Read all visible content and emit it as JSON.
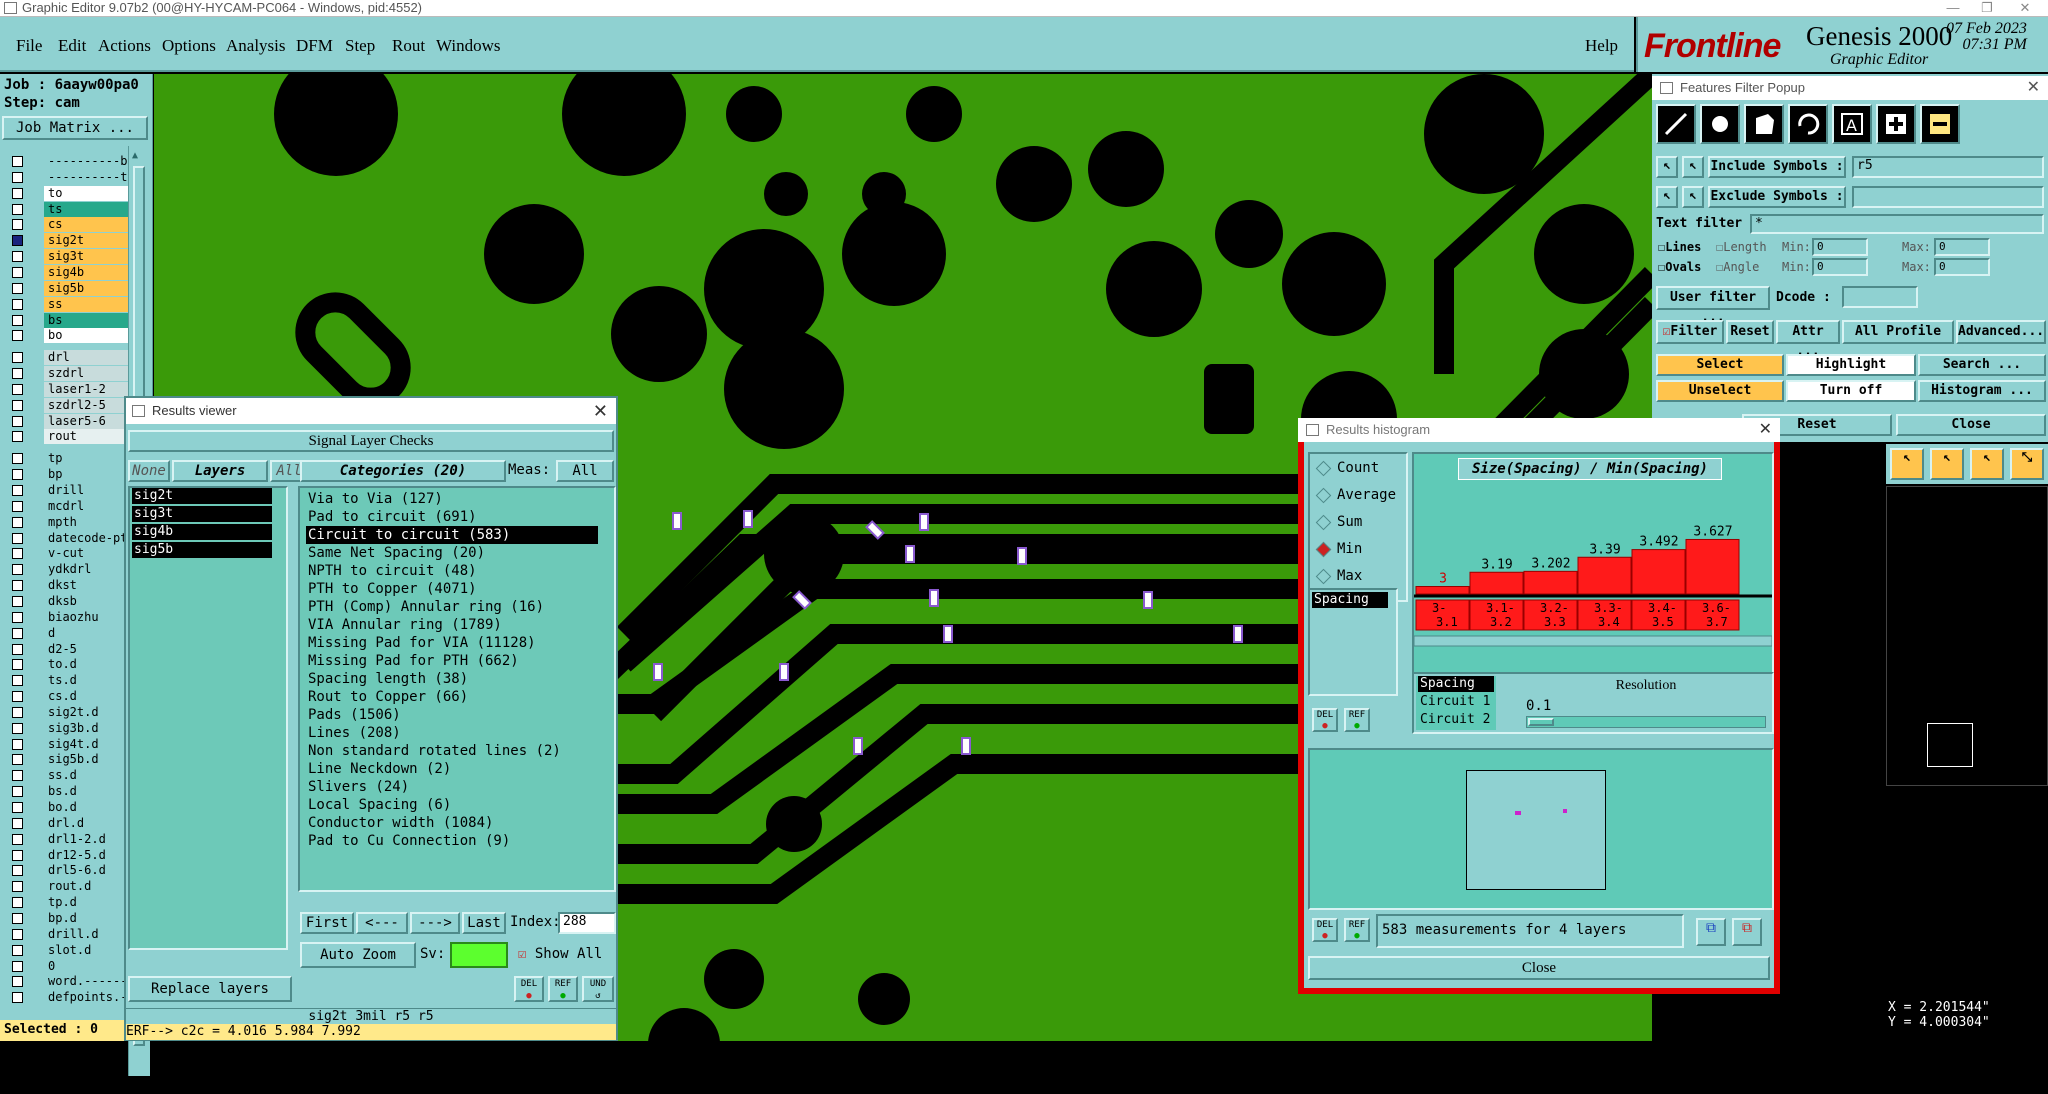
{
  "window_title": "Graphic Editor 9.07b2 (00@HY-HYCAM-PC064 - Windows, pid:4552)",
  "menu": [
    "File",
    "Edit",
    "Actions",
    "Options",
    "Analysis",
    "DFM",
    "Step",
    "Rout",
    "Windows"
  ],
  "help_label": "Help",
  "brand": {
    "logo": "Frontline",
    "product": "Genesis 2000",
    "subtitle": "Graphic Editor",
    "date": "07 Feb 2023",
    "time": "07:31 PM"
  },
  "left_panel": {
    "job": "Job : 6aayw00pa0",
    "step": "Step: cam",
    "job_matrix": "Job Matrix ...",
    "layers": [
      {
        "name": "----------b",
        "color": "#8fd1d1"
      },
      {
        "name": "----------t",
        "color": "#8fd1d1"
      },
      {
        "name": "to",
        "color": "#ffffff"
      },
      {
        "name": "ts",
        "color": "#27a88b"
      },
      {
        "name": "cs",
        "color": "#ffc44d"
      },
      {
        "name": "sig2t",
        "color": "#ffc44d"
      },
      {
        "name": "sig3t",
        "color": "#ffc44d"
      },
      {
        "name": "sig4b",
        "color": "#ffc44d"
      },
      {
        "name": "sig5b",
        "color": "#ffc44d"
      },
      {
        "name": "ss",
        "color": "#ffc44d"
      },
      {
        "name": "bs",
        "color": "#27a88b"
      },
      {
        "name": "bo",
        "color": "#ffffff"
      },
      {
        "name": "drl",
        "color": "#c8dcdc"
      },
      {
        "name": "szdrl",
        "color": "#c8dcdc"
      },
      {
        "name": "laser1-2",
        "color": "#c8dcdc"
      },
      {
        "name": "szdrl2-5",
        "color": "#c8dcdc"
      },
      {
        "name": "laser5-6",
        "color": "#c8dcdc"
      },
      {
        "name": "rout",
        "color": "#e6f0f0"
      },
      {
        "name": "tp",
        "color": "#8fd1d1"
      },
      {
        "name": "bp",
        "color": "#8fd1d1"
      },
      {
        "name": "drill",
        "color": "#8fd1d1"
      },
      {
        "name": "mcdrl",
        "color": "#8fd1d1"
      },
      {
        "name": "mpth",
        "color": "#8fd1d1"
      },
      {
        "name": "datecode-pte",
        "color": "#8fd1d1"
      },
      {
        "name": "v-cut",
        "color": "#8fd1d1"
      },
      {
        "name": "ydkdrl",
        "color": "#8fd1d1"
      },
      {
        "name": "dkst",
        "color": "#8fd1d1"
      },
      {
        "name": "dksb",
        "color": "#8fd1d1"
      },
      {
        "name": "biaozhu",
        "color": "#8fd1d1"
      },
      {
        "name": "d",
        "color": "#8fd1d1"
      },
      {
        "name": "d2-5",
        "color": "#8fd1d1"
      },
      {
        "name": "to.d",
        "color": "#8fd1d1"
      },
      {
        "name": "ts.d",
        "color": "#8fd1d1"
      },
      {
        "name": "cs.d",
        "color": "#8fd1d1"
      },
      {
        "name": "sig2t.d",
        "color": "#8fd1d1"
      },
      {
        "name": "sig3b.d",
        "color": "#8fd1d1"
      },
      {
        "name": "sig4t.d",
        "color": "#8fd1d1"
      },
      {
        "name": "sig5b.d",
        "color": "#8fd1d1"
      },
      {
        "name": "ss.d",
        "color": "#8fd1d1"
      },
      {
        "name": "bs.d",
        "color": "#8fd1d1"
      },
      {
        "name": "bo.d",
        "color": "#8fd1d1"
      },
      {
        "name": "drl.d",
        "color": "#8fd1d1"
      },
      {
        "name": "drl1-2.d",
        "color": "#8fd1d1"
      },
      {
        "name": "dr12-5.d",
        "color": "#8fd1d1"
      },
      {
        "name": "drl5-6.d",
        "color": "#8fd1d1"
      },
      {
        "name": "rout.d",
        "color": "#8fd1d1"
      },
      {
        "name": "tp.d",
        "color": "#8fd1d1"
      },
      {
        "name": "bp.d",
        "color": "#8fd1d1"
      },
      {
        "name": "drill.d",
        "color": "#8fd1d1"
      },
      {
        "name": "slot.d",
        "color": "#8fd1d1"
      },
      {
        "name": "0",
        "color": "#8fd1d1"
      },
      {
        "name": "word.-------",
        "color": "#8fd1d1"
      },
      {
        "name": "defpoints.-",
        "color": "#8fd1d1"
      }
    ],
    "selected": "Selected : 0"
  },
  "results_viewer": {
    "title": "Results viewer",
    "heading": "Signal Layer Checks",
    "none_btn": "None",
    "layers_btn": "Layers",
    "all_btn": "All",
    "layers": [
      "sig2t",
      "sig3t",
      "sig4b",
      "sig5b"
    ],
    "categories_btn": "Categories (20)",
    "meas_label": "Meas:",
    "meas_value": "All",
    "categories": [
      "Via to Via (127)",
      "Pad to circuit (691)",
      "Circuit to circuit (583)",
      "Same Net Spacing (20)",
      "NPTH to circuit (48)",
      "PTH to Copper (4071)",
      "PTH (Comp) Annular ring (16)",
      "VIA Annular ring (1789)",
      "Missing Pad for VIA (11128)",
      "Missing Pad for PTH (662)",
      "Spacing length (38)",
      "Rout to Copper (66)",
      "Pads (1506)",
      "Lines (208)",
      "Non standard rotated lines (2)",
      "Line Neckdown (2)",
      "Slivers (24)",
      "Local Spacing (6)",
      "Conductor width (1084)",
      "Pad to Cu Connection (9)"
    ],
    "selected_category_index": 2,
    "first": "First",
    "prev": "<---",
    "next": "--->",
    "last": "Last",
    "index_label": "Index:",
    "index_value": "288",
    "replace_layers": "Replace layers",
    "auto_zoom": "Auto Zoom",
    "sv_label": "Sv:",
    "show_all": "Show All",
    "del": "DEL",
    "ref": "REF",
    "und": "UND",
    "status1": "sig2t 3mil  r5  r5",
    "status2": "ERF--> c2c = 4.016 5.984 7.992"
  },
  "features_filter": {
    "title": "Features Filter Popup",
    "include_symbols": "Include Symbols :",
    "include_value": "r5",
    "exclude_symbols": "Exclude Symbols :",
    "text_filter": "Text filter",
    "text_value": "*",
    "lines": "Lines",
    "ovals": "Ovals",
    "length": "Length",
    "angle": "Angle",
    "min": "Min:",
    "max": "Max:",
    "zero": "0",
    "user_filter": "User filter ...",
    "dcode": "Dcode :",
    "filter": "Filter",
    "reset": "Reset",
    "attr": "Attr ...",
    "all_profile": "All Profile",
    "advanced": "Advanced...",
    "select": "Select",
    "highlight": "Highlight",
    "search": "Search ...",
    "unselect": "Unselect",
    "turn_off": "Turn off",
    "histogram": "Histogram ...",
    "reset2": "Reset",
    "close": "Close"
  },
  "histogram": {
    "title": "Results histogram",
    "modes": [
      "Count",
      "Average",
      "Sum",
      "Min",
      "Max"
    ],
    "selected_mode": "Min",
    "measure": "Spacing",
    "chart_title": "Size(Spacing) / Min(Spacing)",
    "chart_data": {
      "type": "bar",
      "categories": [
        "3-3.1",
        "3.1-3.2",
        "3.2-3.3",
        "3.3-3.4",
        "3.4-3.5",
        "3.6-3.7"
      ],
      "values": [
        3,
        3.19,
        3.202,
        3.39,
        3.492,
        3.627
      ],
      "value_labels": [
        "3",
        "3.19",
        "3.202",
        "3.39",
        "3.492",
        "3.627"
      ],
      "cat_labels_top": [
        "3-",
        "3.1-",
        "3.2-",
        "3.3-",
        "3.4-",
        "3.6-"
      ],
      "cat_labels_bottom": [
        "3.1",
        "3.2",
        "3.3",
        "3.4",
        "3.5",
        "3.7"
      ],
      "ylim": [
        2.9,
        3.7
      ]
    },
    "list": [
      "Spacing",
      "Circuit 1",
      "Circuit 2"
    ],
    "resolution_label": "Resolution",
    "resolution_value": "0.1",
    "del": "DEL",
    "ref": "REF",
    "summary": "583 measurements for 4 layers",
    "close": "Close"
  },
  "coords": {
    "x": "X = 2.201544\"",
    "y": "Y = 4.000304\""
  }
}
